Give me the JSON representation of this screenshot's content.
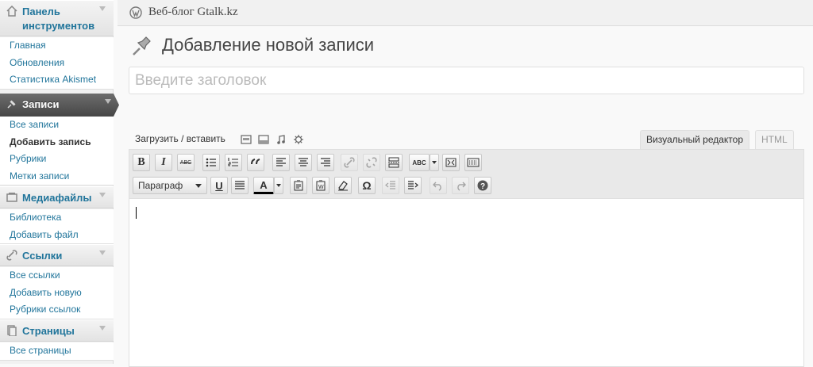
{
  "sidebar": {
    "dashboard": {
      "label": "Панель инструментов",
      "items": [
        "Главная",
        "Обновления",
        "Статистика Akismet"
      ]
    },
    "posts": {
      "label": "Записи",
      "items": [
        "Все записи",
        "Добавить запись",
        "Рубрики",
        "Метки записи"
      ]
    },
    "media": {
      "label": "Медиафайлы",
      "items": [
        "Библиотека",
        "Добавить файл"
      ]
    },
    "links": {
      "label": "Ссылки",
      "items": [
        "Все ссылки",
        "Добавить новую",
        "Рубрики ссылок"
      ]
    },
    "pages": {
      "label": "Страницы",
      "items": [
        "Все страницы"
      ]
    }
  },
  "header": {
    "site_name": "Веб-блог Gtalk.kz"
  },
  "page": {
    "title": "Добавление новой записи",
    "title_placeholder": "Введите заголовок",
    "upload_label": "Загрузить / вставить"
  },
  "editor": {
    "tabs": {
      "visual": "Визуальный редактор",
      "html": "HTML"
    },
    "format_select": "Параграф",
    "spellcheck_label": "ABC",
    "strike_label": "ABC",
    "omega": "Ω",
    "bold": "B",
    "italic": "I",
    "underline": "U",
    "text_color": "A"
  },
  "colors": {
    "link": "#21759b",
    "active_menu": "#464646"
  }
}
